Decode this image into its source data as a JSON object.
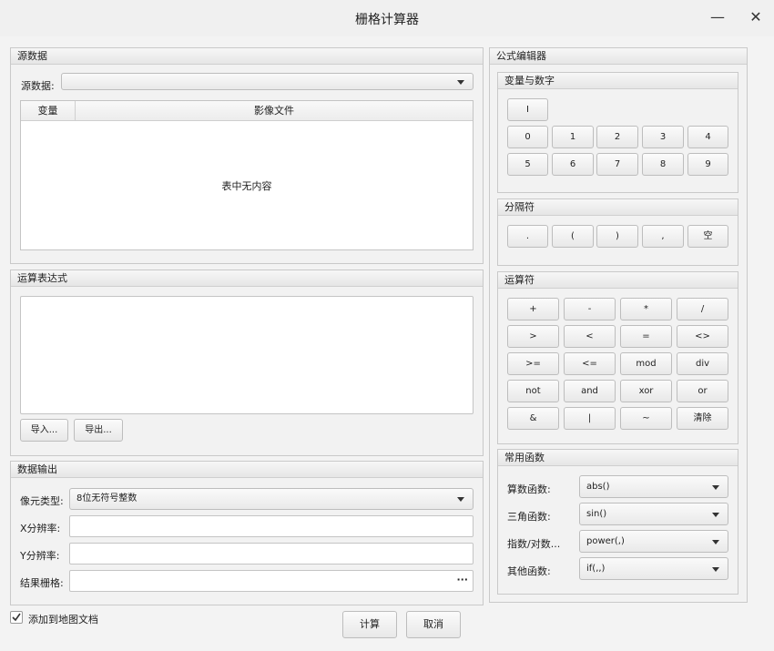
{
  "window": {
    "title": "栅格计算器",
    "minimize": "—",
    "close": "✕"
  },
  "source": {
    "section_title": "源数据",
    "label": "源数据:",
    "value": "",
    "table": {
      "col_variable": "变量",
      "col_image": "影像文件",
      "empty_text": "表中无内容"
    }
  },
  "expression": {
    "section_title": "运算表达式",
    "value": "",
    "import_label": "导入...",
    "export_label": "导出..."
  },
  "output": {
    "section_title": "数据输出",
    "pixel_type_label": "像元类型:",
    "pixel_type_value": "8位无符号整数",
    "x_res_label": "X分辨率:",
    "x_res_value": "",
    "y_res_label": "Y分辨率:",
    "y_res_value": "",
    "result_label": "结果栅格:",
    "result_value": "",
    "browse_label": "···"
  },
  "add_to_map": {
    "label": "添加到地图文档",
    "checked": true
  },
  "actions": {
    "compute": "计算",
    "cancel": "取消"
  },
  "formula": {
    "section_title": "公式编辑器",
    "vars": {
      "title": "变量与数字",
      "cursor_btn": "I",
      "digits": [
        "0",
        "1",
        "2",
        "3",
        "4",
        "5",
        "6",
        "7",
        "8",
        "9"
      ]
    },
    "separators": {
      "title": "分隔符",
      "items": [
        ".",
        "(",
        ")",
        ",",
        "空"
      ]
    },
    "operators": {
      "title": "运算符",
      "rows": [
        [
          "+",
          "-",
          "*",
          "/"
        ],
        [
          ">",
          "<",
          "=",
          "<>"
        ],
        [
          ">=",
          "<=",
          "mod",
          "div"
        ],
        [
          "not",
          "and",
          "xor",
          "or"
        ],
        [
          "&",
          "|",
          "~",
          "清除"
        ]
      ]
    },
    "functions": {
      "title": "常用函数",
      "arith_label": "算数函数:",
      "arith_value": "abs()",
      "trig_label": "三角函数:",
      "trig_value": "sin()",
      "exp_label": "指数/对数...",
      "exp_value": "power(,)",
      "other_label": "其他函数:",
      "other_value": "if(,,)"
    }
  }
}
